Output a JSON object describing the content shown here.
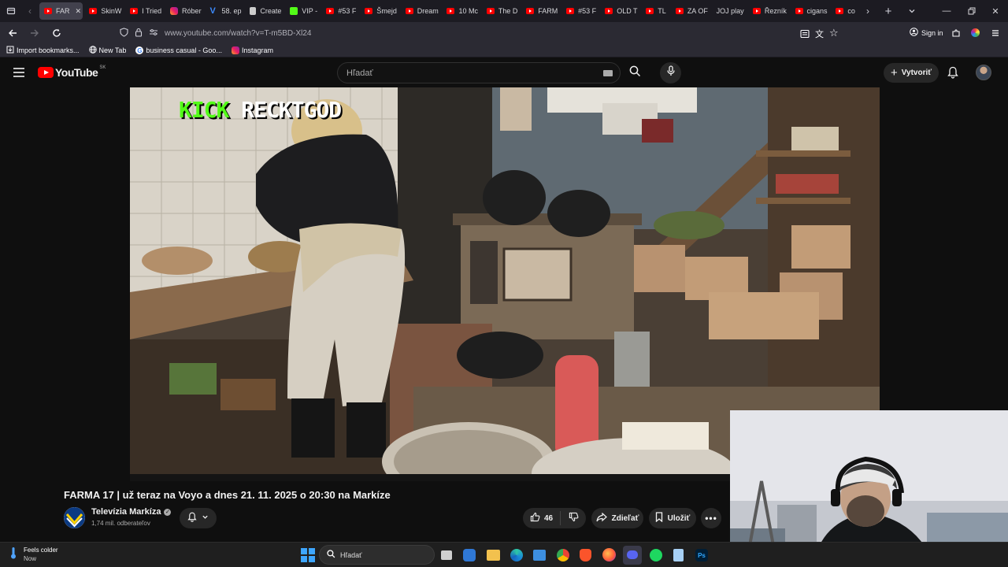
{
  "browser": {
    "tabs": [
      {
        "label": "FAR",
        "icon": "youtube-icon",
        "active": true
      },
      {
        "label": "SkinW",
        "icon": "youtube-icon"
      },
      {
        "label": "I Tried",
        "icon": "youtube-icon"
      },
      {
        "label": "Róber",
        "icon": "instagram-icon"
      },
      {
        "label": "58. ep",
        "icon": "v-icon"
      },
      {
        "label": "Create",
        "icon": "doc-icon"
      },
      {
        "label": "VIP -",
        "icon": "kick-icon"
      },
      {
        "label": "#53 F",
        "icon": "youtube-icon"
      },
      {
        "label": "Šmejd",
        "icon": "youtube-icon"
      },
      {
        "label": "Dream",
        "icon": "youtube-icon"
      },
      {
        "label": "10 Mc",
        "icon": "youtube-icon"
      },
      {
        "label": "The D",
        "icon": "youtube-icon"
      },
      {
        "label": "FARM",
        "icon": "youtube-icon"
      },
      {
        "label": "#53 F",
        "icon": "youtube-icon"
      },
      {
        "label": "OLD T",
        "icon": "youtube-icon"
      },
      {
        "label": "TL",
        "icon": "youtube-icon"
      },
      {
        "label": "ZA OF",
        "icon": "youtube-icon"
      },
      {
        "label": "JOJ play",
        "icon": "none"
      },
      {
        "label": "Řezník",
        "icon": "youtube-icon"
      },
      {
        "label": "cigans",
        "icon": "youtube-icon"
      },
      {
        "label": "co",
        "icon": "youtube-icon"
      }
    ],
    "url": "www.youtube.com/watch?v=T-m5BD-Xl24",
    "sign_in": "Sign in",
    "bookmarks": [
      {
        "label": "Import bookmarks...",
        "icon": "import-icon"
      },
      {
        "label": "New Tab",
        "icon": "globe-icon"
      },
      {
        "label": "business casual - Goo...",
        "icon": "google-icon"
      },
      {
        "label": "Instagram",
        "icon": "instagram-icon"
      }
    ]
  },
  "youtube": {
    "logo_text": "YouTube",
    "region": "SK",
    "search_placeholder": "Hľadať",
    "create_label": "Vytvoriť",
    "overlay_text_green": "KICK",
    "overlay_text_white": "RECKTGOD",
    "video_title": "FARMA 17 | už teraz na Voyo a dnes 21. 11. 2025 o 20:30 na Markíze",
    "channel_name": "Televízia Markíza",
    "subscribers": "1,74 mil. odberateľov",
    "like_count": "46",
    "share_label": "Zdieľať",
    "save_label": "Uložiť"
  },
  "taskbar": {
    "weather_title": "Feels colder",
    "weather_sub": "Now",
    "search_placeholder": "Hľadať"
  },
  "colors": {
    "youtube_red": "#ff0000",
    "kick_green": "#53fc18",
    "background": "#0f0f0f"
  }
}
